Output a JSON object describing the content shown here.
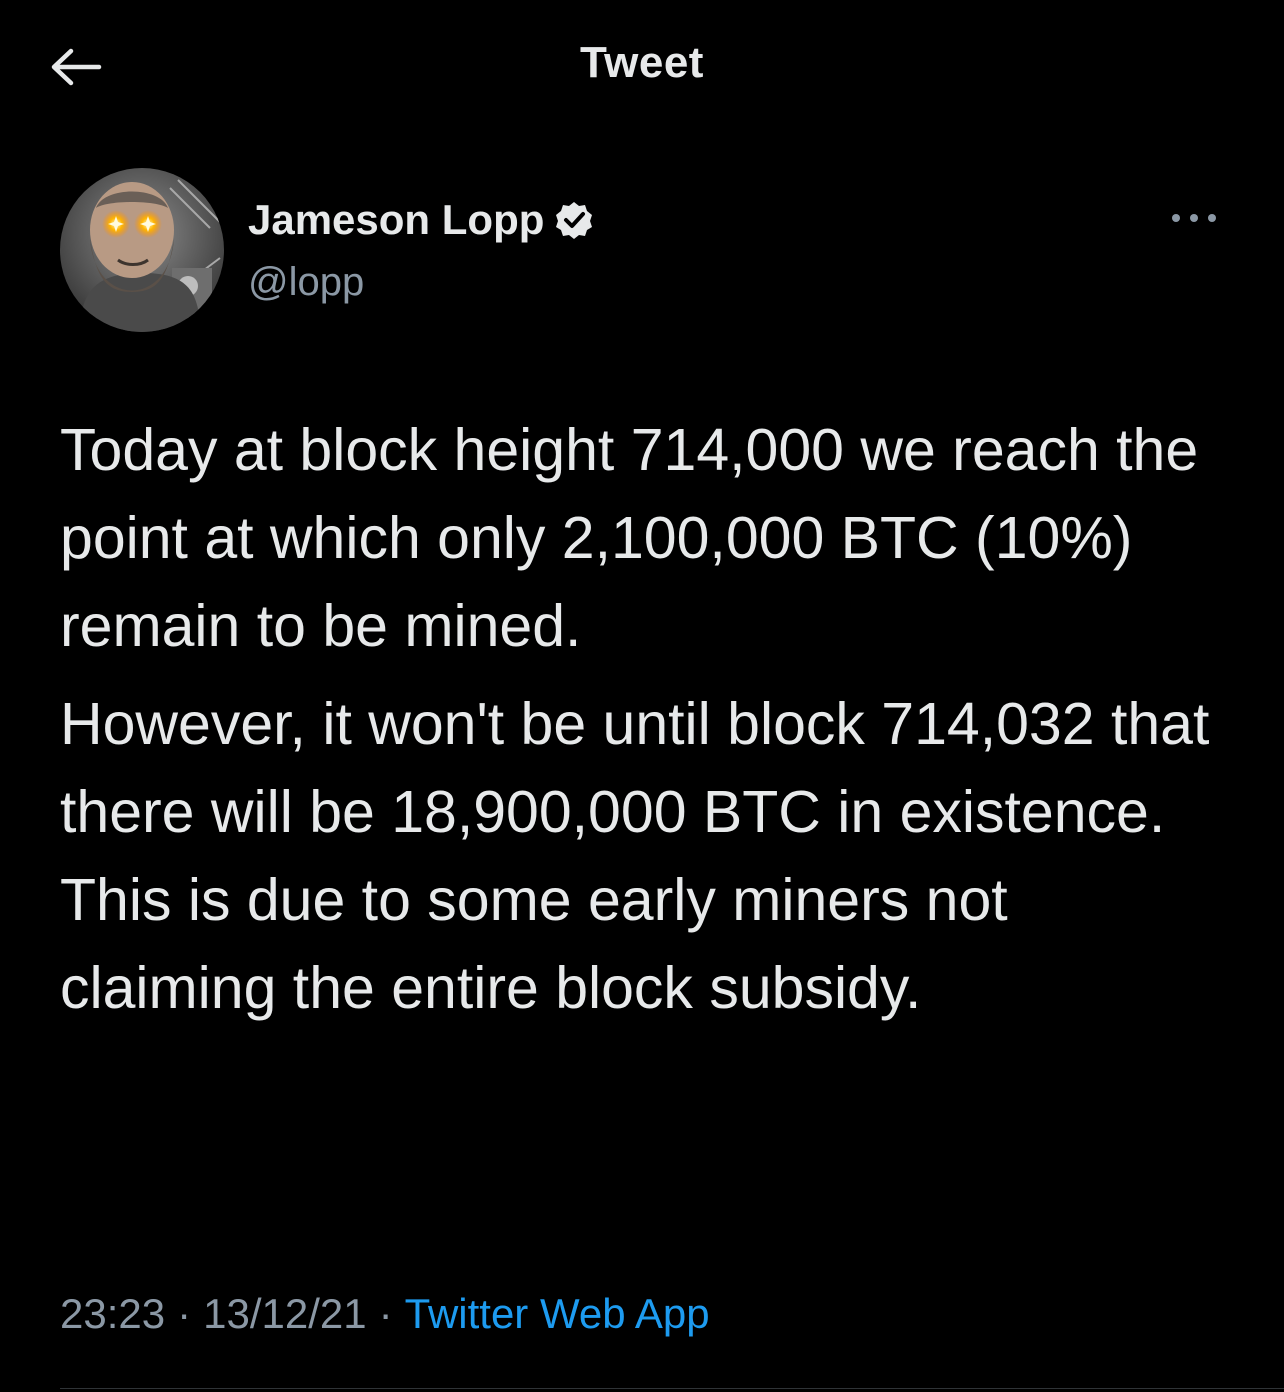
{
  "header": {
    "back_icon": "arrow-left-icon",
    "title": "Tweet"
  },
  "author": {
    "display_name": "Jameson Lopp",
    "verified_icon": "verified-badge-icon",
    "handle": "@lopp",
    "more_icon": "more-horizontal-icon"
  },
  "tweet": {
    "paragraphs": [
      "Today at block height 714,000 we reach the point at which only 2,100,000 BTC (10%) remain to be mined.",
      "However, it won't be until block 714,032 that there will be 18,900,000 BTC in existence. This is due to some early miners not claiming the entire block subsidy."
    ]
  },
  "meta": {
    "time": "23:23",
    "separator": "·",
    "date": "13/12/21",
    "source": "Twitter Web App"
  },
  "colors": {
    "background": "#000000",
    "text_primary": "#e7e9ea",
    "text_secondary": "#8b98a5",
    "accent": "#1d9bf0",
    "divider": "#2f3336"
  }
}
